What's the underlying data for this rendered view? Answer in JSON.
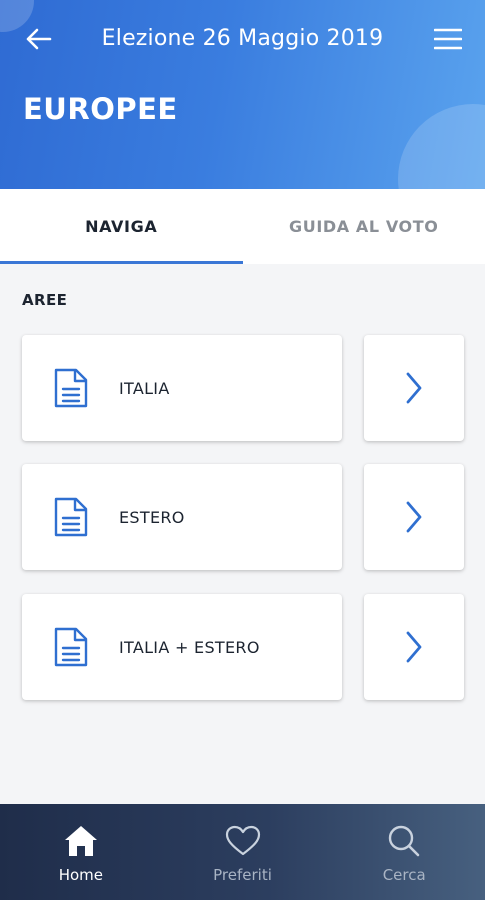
{
  "header": {
    "title": "Elezione 26 Maggio 2019",
    "page_title": "EUROPEE",
    "gradient_start": "#2f6bd3",
    "gradient_end": "#5aa3ee",
    "back_icon": "arrow-left-icon",
    "menu_icon": "hamburger-menu-icon"
  },
  "tabs": [
    {
      "label": "NAVIGA",
      "active": true
    },
    {
      "label": "GUIDA AL VOTO",
      "active": false
    }
  ],
  "section": {
    "label": "AREE"
  },
  "areas": [
    {
      "label": "ITALIA",
      "icon": "document-icon",
      "arrow_icon": "chevron-right-icon"
    },
    {
      "label": "ESTERO",
      "icon": "document-icon",
      "arrow_icon": "chevron-right-icon"
    },
    {
      "label": "ITALIA + ESTERO",
      "icon": "document-icon",
      "arrow_icon": "chevron-right-icon"
    }
  ],
  "bottom_nav": [
    {
      "label": "Home",
      "icon": "home-icon",
      "active": true
    },
    {
      "label": "Preferiti",
      "icon": "heart-icon",
      "active": false
    },
    {
      "label": "Cerca",
      "icon": "search-icon",
      "active": false
    }
  ],
  "colors": {
    "accent": "#3a77d6",
    "icon_blue": "#2f6fd0",
    "nav_background": "#1f2d4a",
    "page_background": "#f4f5f7"
  }
}
